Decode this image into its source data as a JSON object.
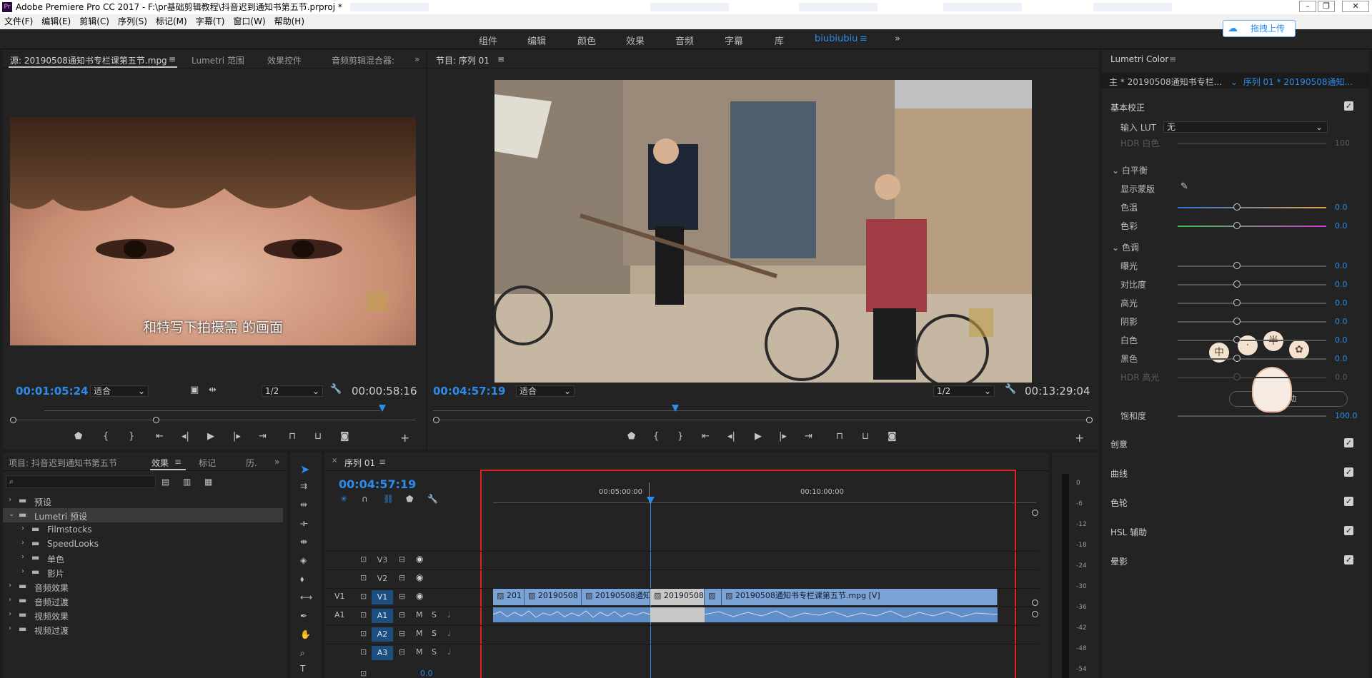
{
  "window": {
    "title": "Adobe Premiere Pro CC 2017 - F:\\pr基础剪辑教程\\抖音迟到通知书第五节.prproj *"
  },
  "menu": [
    "文件(F)",
    "编辑(E)",
    "剪辑(C)",
    "序列(S)",
    "标记(M)",
    "字幕(T)",
    "窗口(W)",
    "帮助(H)"
  ],
  "workspaces": [
    "组件",
    "编辑",
    "颜色",
    "效果",
    "音频",
    "字幕",
    "库",
    "biubiubiu"
  ],
  "upload_label": "拖拽上传",
  "source": {
    "tabs": [
      "源: 20190508通知书专栏课第五节.mpg",
      "Lumetri 范围",
      "效果控件",
      "音频剪辑混合器:"
    ],
    "subtitle": "和特写下拍摄需 的画面",
    "timecode": "00:01:05:24",
    "fit": "适合",
    "resolution": "1/2",
    "duration": "00:00:58:16"
  },
  "program": {
    "tab": "节目: 序列 01",
    "timecode": "00:04:57:19",
    "fit": "适合",
    "resolution": "1/2",
    "duration": "00:13:29:04"
  },
  "project": {
    "tabs": [
      "项目: 抖音迟到通知书第五节",
      "效果",
      "标记",
      "历."
    ],
    "tree": [
      {
        "label": "预设",
        "level": 0
      },
      {
        "label": "Lumetri 预设",
        "level": 0,
        "selected": true
      },
      {
        "label": "Filmstocks",
        "level": 1
      },
      {
        "label": "SpeedLooks",
        "level": 1
      },
      {
        "label": "单色",
        "level": 1
      },
      {
        "label": "影片",
        "level": 1
      },
      {
        "label": "音频效果",
        "level": 0
      },
      {
        "label": "音频过渡",
        "level": 0
      },
      {
        "label": "视频效果",
        "level": 0
      },
      {
        "label": "视频过渡",
        "level": 0
      }
    ]
  },
  "timeline": {
    "tab": "序列 01",
    "timecode": "00:04:57:19",
    "ruler": [
      "00:05:00:00",
      "00:10:00:00"
    ],
    "video_tracks": [
      "V3",
      "V2",
      "V1"
    ],
    "audio_tracks": [
      "A1",
      "A2",
      "A3"
    ],
    "source_v": "V1",
    "source_a": "A1",
    "mix_value": "0.0",
    "clips": [
      "201",
      "20190508",
      "20190508通知",
      "20190508",
      "20190508通知书专栏课第五节.mpg [V]"
    ],
    "meter_scale": [
      "0",
      "-6",
      "-12",
      "-18",
      "-24",
      "-30",
      "-36",
      "-42",
      "-48",
      "-54"
    ]
  },
  "lumetri": {
    "title": "Lumetri Color",
    "master": "主 * 20190508通知书专栏...",
    "seq": "序列 01 * 20190508通知...",
    "basic": "基本校正",
    "lut_label": "输入 LUT",
    "lut_value": "无",
    "hdr_white": "HDR 白色",
    "hdr_white_val": "100",
    "wb": "白平衡",
    "show_mask": "显示蒙版",
    "rows_wb": [
      {
        "label": "色温",
        "val": "0.0"
      },
      {
        "label": "色彩",
        "val": "0.0"
      }
    ],
    "tone": "色调",
    "rows_tone": [
      {
        "label": "曝光",
        "val": "0.0"
      },
      {
        "label": "对比度",
        "val": "0.0"
      },
      {
        "label": "高光",
        "val": "0.0"
      },
      {
        "label": "阴影",
        "val": "0.0"
      },
      {
        "label": "白色",
        "val": "0.0"
      },
      {
        "label": "黑色",
        "val": "0.0"
      },
      {
        "label": "HDR 高光",
        "val": "0.0"
      }
    ],
    "auto": "自动",
    "saturation": "饱和度",
    "saturation_val": "100.0",
    "sections": [
      "创意",
      "曲线",
      "色轮",
      "HSL 辅助",
      "晕影"
    ]
  }
}
